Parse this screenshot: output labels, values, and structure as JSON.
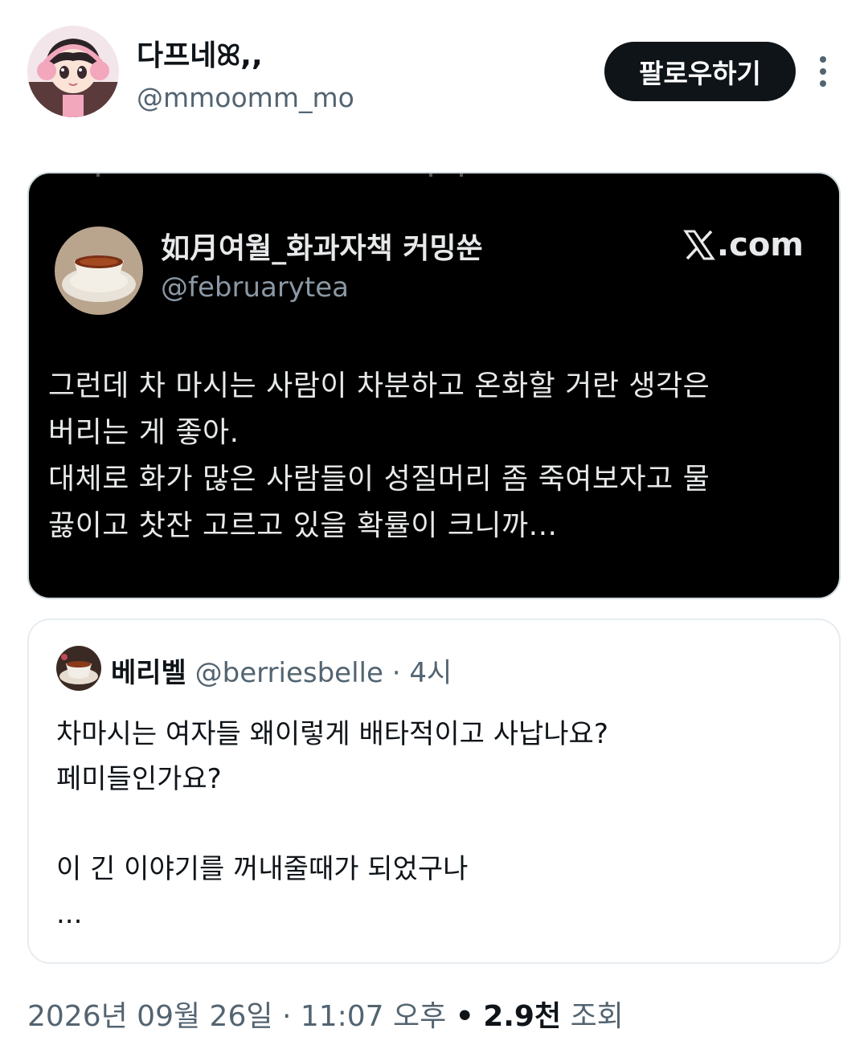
{
  "author": {
    "display_name": "다프네ꕤ,,",
    "handle": "@mmoomm_mo",
    "follow_label": "팔로우하기"
  },
  "embed": {
    "name": "如月여월_화과자책 커밍쑨",
    "handle": "@februarytea",
    "source": ".com",
    "lines": [
      "그런데 차 마시는 사람이 차분하고 온화할 거란 생각은",
      "버리는 게 좋아.",
      "대체로 화가 많은 사람들이 성질머리 좀 죽여보자고 물",
      "끓이고 찻잔 고르고 있을 확률이 크니까..."
    ]
  },
  "quote": {
    "name": "베리벨",
    "handle": "@berriesbelle",
    "separator": "·",
    "time": "4시",
    "lines": [
      "차마시는 여자들 왜이렇게 배타적이고 사납나요?",
      "페미들인가요?",
      "",
      "이 긴 이야기를 꺼내줄때가 되었구나",
      "..."
    ]
  },
  "footer": {
    "date": "2026년 09월 26일",
    "sep1": "·",
    "time": "11:07 오후",
    "sep2": "•",
    "views_count": "2.9천",
    "views_label": "조회"
  },
  "colors": {
    "text_primary": "#0f1419",
    "text_secondary": "#536471",
    "embed_background": "#000000",
    "follow_button": "#0f1419"
  },
  "icons": {
    "more": "more-vertical-icon",
    "source": "x-logo-icon"
  }
}
